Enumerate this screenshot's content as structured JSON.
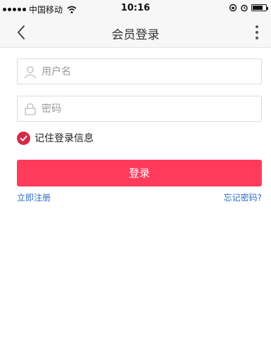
{
  "status_bar": {
    "carrier": "中国移动",
    "time": "10:16",
    "battery_level": 0.8
  },
  "nav": {
    "title": "会员登录",
    "back_icon": "chevron-left-icon",
    "more_icon": "more-vertical-icon"
  },
  "form": {
    "username_placeholder": "用户名",
    "username_value": "",
    "password_placeholder": "密码",
    "password_value": "",
    "remember_label": "记住登录信息",
    "remember_checked": true,
    "login_label": "登录"
  },
  "links": {
    "register": "立即注册",
    "forgot": "忘记密码?"
  },
  "colors": {
    "accent": "#ff3b5c",
    "check": "#d52b48",
    "link": "#2b6cc4"
  }
}
